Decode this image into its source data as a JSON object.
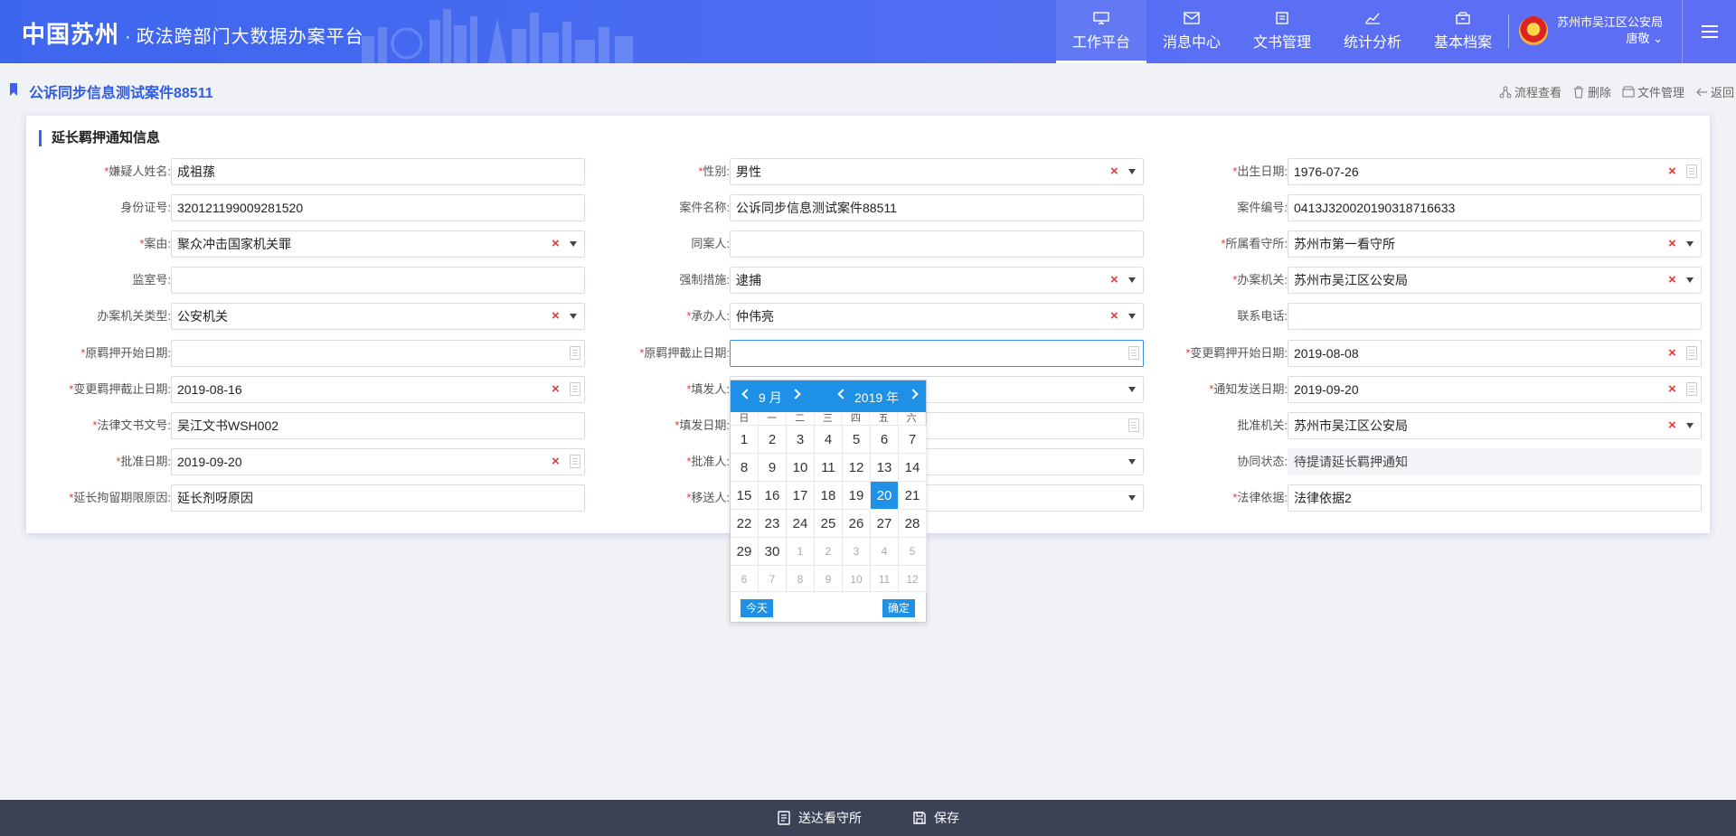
{
  "header": {
    "brand_main": "中国苏州",
    "brand_dot": "·",
    "brand_sub": "政法跨部门大数据办案平台",
    "nav": [
      {
        "label": "工作平台",
        "icon": "monitor-icon",
        "active": true
      },
      {
        "label": "消息中心",
        "icon": "mail-icon",
        "active": false
      },
      {
        "label": "文书管理",
        "icon": "document-icon",
        "active": false
      },
      {
        "label": "统计分析",
        "icon": "chart-icon",
        "active": false
      },
      {
        "label": "基本档案",
        "icon": "archive-icon",
        "active": false
      }
    ],
    "user_org": "苏州市吴江区公安局",
    "user_name": "唐敬"
  },
  "page": {
    "title": "公诉同步信息测试案件88511",
    "actions": [
      {
        "label": "流程查看",
        "icon": "flow-icon"
      },
      {
        "label": "删除",
        "icon": "trash-icon"
      },
      {
        "label": "文件管理",
        "icon": "folder-icon"
      },
      {
        "label": "返回",
        "icon": "back-arrow-icon"
      }
    ]
  },
  "form": {
    "title": "延长羁押通知信息",
    "fields": [
      {
        "label": "嫌疑人姓名:",
        "required": true,
        "value": "成祖蓀",
        "type": "text"
      },
      {
        "label": "性别:",
        "required": true,
        "value": "男性",
        "type": "select"
      },
      {
        "label": "出生日期:",
        "required": true,
        "value": "1976-07-26",
        "type": "date"
      },
      {
        "label": "身份证号:",
        "required": false,
        "value": "320121199009281520",
        "type": "text"
      },
      {
        "label": "案件名称:",
        "required": false,
        "value": "公诉同步信息测试案件88511",
        "type": "text"
      },
      {
        "label": "案件编号:",
        "required": false,
        "value": "0413J320020190318716633",
        "type": "text"
      },
      {
        "label": "案由:",
        "required": true,
        "value": "聚众冲击国家机关罪",
        "type": "select"
      },
      {
        "label": "同案人:",
        "required": false,
        "value": "",
        "type": "text"
      },
      {
        "label": "所属看守所:",
        "required": true,
        "value": "苏州市第一看守所",
        "type": "select"
      },
      {
        "label": "监室号:",
        "required": false,
        "value": "",
        "type": "text"
      },
      {
        "label": "强制措施:",
        "required": false,
        "value": "逮捕",
        "type": "select"
      },
      {
        "label": "办案机关:",
        "required": true,
        "value": "苏州市吴江区公安局",
        "type": "select"
      },
      {
        "label": "办案机关类型:",
        "required": false,
        "value": "公安机关",
        "type": "select"
      },
      {
        "label": "承办人:",
        "required": true,
        "value": "仲伟亮",
        "type": "select"
      },
      {
        "label": "联系电话:",
        "required": false,
        "value": "",
        "type": "text"
      },
      {
        "label": "原羁押开始日期:",
        "required": true,
        "value": "",
        "type": "date"
      },
      {
        "label": "原羁押截止日期:",
        "required": true,
        "value": "",
        "type": "date",
        "focused": true
      },
      {
        "label": "变更羁押开始日期:",
        "required": true,
        "value": "2019-08-08",
        "type": "date"
      },
      {
        "label": "变更羁押截止日期:",
        "required": true,
        "value": "2019-08-16",
        "type": "date"
      },
      {
        "label": "填发人:",
        "required": true,
        "value": "",
        "type": "select"
      },
      {
        "label": "通知发送日期:",
        "required": true,
        "value": "2019-09-20",
        "type": "date"
      },
      {
        "label": "法律文书文号:",
        "required": true,
        "value": "吴江文书WSH002",
        "type": "text"
      },
      {
        "label": "填发日期:",
        "required": true,
        "value": "",
        "type": "date"
      },
      {
        "label": "批准机关:",
        "required": false,
        "value": "苏州市吴江区公安局",
        "type": "select"
      },
      {
        "label": "批准日期:",
        "required": true,
        "value": "2019-09-20",
        "type": "date"
      },
      {
        "label": "批准人:",
        "required": true,
        "value": "",
        "type": "select"
      },
      {
        "label": "协同状态:",
        "required": false,
        "value": "待提请延长羁押通知",
        "type": "readonly"
      },
      {
        "label": "延长拘留期限原因:",
        "required": true,
        "value": "延长剂呀原因",
        "type": "text"
      },
      {
        "label": "移送人:",
        "required": true,
        "value": "",
        "type": "select"
      },
      {
        "label": "法律依据:",
        "required": true,
        "value": "法律依据2",
        "type": "text"
      }
    ]
  },
  "datepicker": {
    "month": "9",
    "month_suffix": "月",
    "year": "2019",
    "year_suffix": "年",
    "weekdays": [
      "日",
      "一",
      "二",
      "三",
      "四",
      "五",
      "六"
    ],
    "days": [
      {
        "d": "1"
      },
      {
        "d": "2"
      },
      {
        "d": "3"
      },
      {
        "d": "4"
      },
      {
        "d": "5"
      },
      {
        "d": "6"
      },
      {
        "d": "7"
      },
      {
        "d": "8"
      },
      {
        "d": "9"
      },
      {
        "d": "10"
      },
      {
        "d": "11"
      },
      {
        "d": "12"
      },
      {
        "d": "13"
      },
      {
        "d": "14"
      },
      {
        "d": "15"
      },
      {
        "d": "16"
      },
      {
        "d": "17"
      },
      {
        "d": "18"
      },
      {
        "d": "19"
      },
      {
        "d": "20",
        "selected": true
      },
      {
        "d": "21"
      },
      {
        "d": "22"
      },
      {
        "d": "23"
      },
      {
        "d": "24"
      },
      {
        "d": "25"
      },
      {
        "d": "26"
      },
      {
        "d": "27"
      },
      {
        "d": "28"
      },
      {
        "d": "29"
      },
      {
        "d": "30"
      },
      {
        "d": "1",
        "out": true
      },
      {
        "d": "2",
        "out": true
      },
      {
        "d": "3",
        "out": true
      },
      {
        "d": "4",
        "out": true
      },
      {
        "d": "5",
        "out": true
      },
      {
        "d": "6",
        "out": true
      },
      {
        "d": "7",
        "out": true
      },
      {
        "d": "8",
        "out": true
      },
      {
        "d": "9",
        "out": true
      },
      {
        "d": "10",
        "out": true
      },
      {
        "d": "11",
        "out": true
      },
      {
        "d": "12",
        "out": true
      }
    ],
    "today_label": "今天",
    "ok_label": "确定"
  },
  "footer": {
    "send_label": "送达看守所",
    "save_label": "保存"
  },
  "colors": {
    "primary": "#3a63e9",
    "picker_blue": "#1e90e6",
    "required_red": "#e53935",
    "footer_bg": "#3c4256"
  }
}
